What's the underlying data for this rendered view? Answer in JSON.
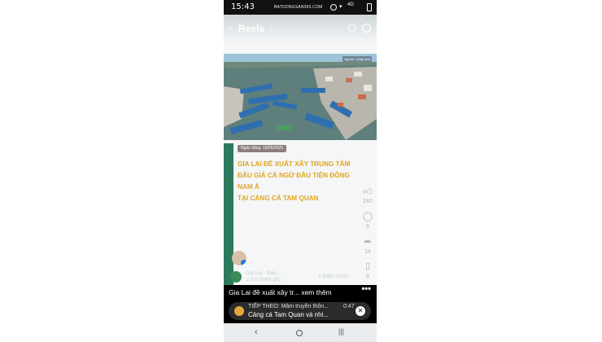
{
  "status_bar": {
    "time": "15:43",
    "watermark": "BATDONGSAN365.COM",
    "signal": "4G"
  },
  "header": {
    "title": "Reels",
    "chevron": "chevron-down-icon",
    "search_icon": "search-icon",
    "menu_icon": "more-icon"
  },
  "post": {
    "date_badge": "Ngày đăng: 15/05/2025",
    "headline_lines": [
      "GIA LAI ĐỀ XUẤT XÂY TRUNG TÂM",
      "ĐẤU GIÁ CÁ NGỪ ĐẦU TIÊN ĐÔNG NAM Á",
      "TẠI CẢNG CÁ TAM QUAN"
    ],
    "page_name": "Gia Lai · Báo…",
    "time_ago": "1 tuần trước",
    "audio": "♫ Âm thanh gốc",
    "photo_mark": "Nguồn: nhiếp ảnh"
  },
  "reactions": {
    "like_count": "240",
    "comment_count": "5",
    "share_count": "14",
    "save_count": "8"
  },
  "caption": {
    "text": "Gia Lai đề xuất xây tr...",
    "more": "xem thêm",
    "dots": "•••"
  },
  "next_up": {
    "label": "TIẾP THEO: Mâm truyền thôn...",
    "duration": "0:47",
    "title": "Cảng cá Tam Quan và nhi...",
    "close": "✕"
  },
  "colors": {
    "headline": "#e3a51c",
    "stripe": "#2d7a5e",
    "statusbar": "#111111"
  }
}
